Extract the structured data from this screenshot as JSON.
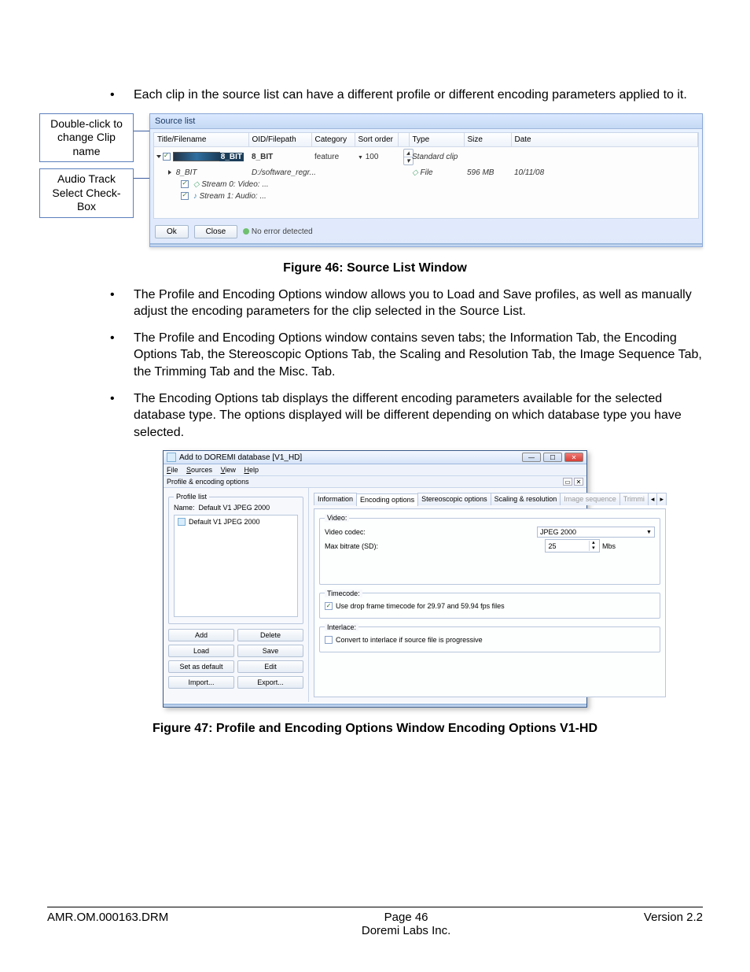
{
  "bullets_top": [
    "Each clip in the source list can have a different profile or different encoding parameters applied to it."
  ],
  "annot1": "Double-click to change Clip name",
  "annot2": "Audio Track Select Check-Box",
  "source_list": {
    "title": "Source list",
    "columns": [
      "Title/Filename",
      "OID/Filepath",
      "Category",
      "Sort order",
      "",
      "Type",
      "Size",
      "Date"
    ],
    "row1": {
      "cells": [
        "8_BIT",
        "8_BIT",
        "feature",
        "100",
        "",
        "Standard clip",
        "",
        ""
      ],
      "tri": true,
      "chk": true,
      "thumb": true
    },
    "row2": {
      "cells": [
        "8_BIT",
        "D:/software_regr...",
        "",
        "",
        "",
        "File",
        "596 MB",
        "10/11/08"
      ],
      "tri_open": true,
      "chk": true
    },
    "row2a": "Stream 0: Video: ...",
    "row2b": "Stream 1: Audio: ...",
    "btn_ok": "Ok",
    "btn_close": "Close",
    "status": "No error detected"
  },
  "caption1": "Figure 46: Source List Window",
  "bullets_mid": [
    "The Profile and Encoding Options window allows you to Load and Save profiles, as well as manually adjust the encoding parameters for the clip selected in the Source List.",
    "The Profile and Encoding Options window contains seven tabs; the Information Tab, the Encoding Options Tab, the Stereoscopic Options Tab, the Scaling and Resolution Tab, the Image Sequence Tab, the Trimming Tab and the Misc. Tab.",
    "The Encoding Options tab displays the different encoding parameters available for the selected database type.  The options displayed will be different depending on which database type you have selected."
  ],
  "profile_win": {
    "title": "Add to DOREMI database [V1_HD]",
    "menus": [
      "File",
      "Sources",
      "View",
      "Help"
    ],
    "subheader": "Profile & encoding options",
    "profile_list_label": "Profile list",
    "name_label": "Name:",
    "name_value": "Default V1 JPEG 2000",
    "list_item": "Default V1 JPEG 2000",
    "buttons": [
      [
        "Add",
        "Delete"
      ],
      [
        "Load",
        "Save"
      ],
      [
        "Set as default",
        "Edit"
      ],
      [
        "Import...",
        "Export..."
      ]
    ],
    "tabs": [
      "Information",
      "Encoding options",
      "Stereoscopic options",
      "Scaling & resolution",
      "Image sequence",
      "Trimmi"
    ],
    "video_legend": "Video:",
    "codec_label": "Video codec:",
    "codec_value": "JPEG 2000",
    "bitrate_label": "Max bitrate (SD):",
    "bitrate_value": "25",
    "bitrate_unit": "Mbs",
    "timecode_legend": "Timecode:",
    "timecode_check": "Use drop frame timecode for 29.97 and 59.94 fps files",
    "interlace_legend": "Interlace:",
    "interlace_check": "Convert to interlace if source file is progressive"
  },
  "caption2": "Figure 47: Profile and Encoding Options Window Encoding Options V1-HD",
  "footer": {
    "left": "AMR.OM.000163.DRM",
    "center_top": "Page 46",
    "center_bottom": "Doremi Labs Inc.",
    "right": "Version 2.2"
  }
}
